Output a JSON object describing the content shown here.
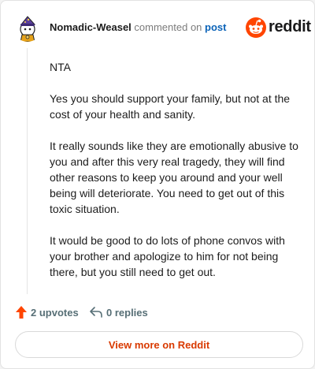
{
  "comment": {
    "author": "Nomadic-Weasel",
    "action_text": "commented on",
    "post_link": "post",
    "paragraphs": [
      "NTA",
      "Yes you should support your family, but not at the cost of your health and sanity.",
      "It really sounds like they are emotionally abusive to you and after this very real tragedy, they will find other reasons to keep you around and your well being will deteriorate. You need to get out of this toxic situation.",
      "It would be good to do lots of phone convos with your brother and apologize to him for not being there, but you still need to get out."
    ]
  },
  "brand": {
    "name": "reddit",
    "icon": "reddit-logo-icon"
  },
  "actions": {
    "upvotes_label": "2 upvotes",
    "upvote_icon": "upvote-arrow-icon",
    "replies_label": "0 replies",
    "reply_icon": "reply-arrow-icon"
  },
  "footer": {
    "view_more_label": "View more on Reddit"
  },
  "colors": {
    "accent": "#ff4500",
    "link": "#0b63b8",
    "view_more_text": "#d93a00",
    "muted": "#576f76"
  }
}
